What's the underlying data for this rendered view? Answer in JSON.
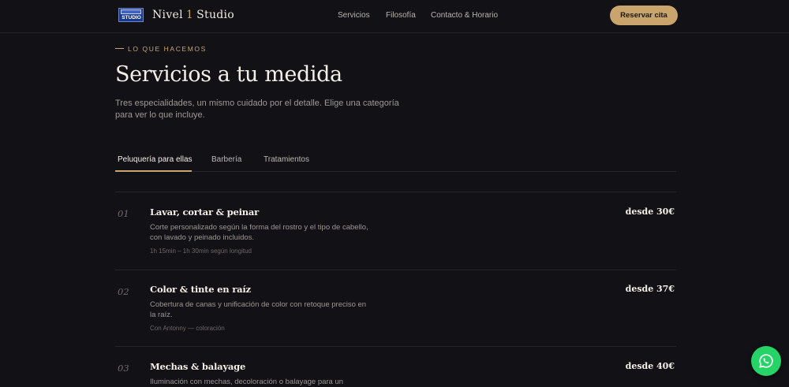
{
  "header": {
    "logo_text_top": "NIVEL 1",
    "logo_text_bottom": "STUDIO",
    "brand_left": "Nivel",
    "brand_num": "1",
    "brand_right": "Studio",
    "nav": [
      "Servicios",
      "Filosofía",
      "Contacto & Horario"
    ],
    "cta_label": "Reservar cita"
  },
  "hero": {
    "eyebrow": "LO QUE HACEMOS",
    "title": "Servicios a tu medida",
    "intro": "Tres especialidades, un mismo cuidado por el detalle. Elige una categoría para ver lo que incluye."
  },
  "tabs": [
    {
      "label": "Peluquería para ellas",
      "active": true
    },
    {
      "label": "Barbería",
      "active": false
    },
    {
      "label": "Tratamientos",
      "active": false
    }
  ],
  "services": [
    {
      "num": "01",
      "name": "Lavar, cortar & peinar",
      "price": "desde 30€",
      "desc": "Corte personalizado según la forma del rostro y el tipo de cabello, con lavado y peinado incluidos.",
      "meta": "1h 15min – 1h 30min según longitud"
    },
    {
      "num": "02",
      "name": "Color & tinte en raíz",
      "price": "desde 37€",
      "desc": "Cobertura de canas y unificación de color con retoque preciso en la raíz.",
      "meta": "Con Antonny — coloración"
    },
    {
      "num": "03",
      "name": "Mechas & balayage",
      "price": "desde 40€",
      "desc": "Iluminación con mechas, decoloración o balayage para un",
      "meta": ""
    }
  ],
  "colors": {
    "background": "#121116",
    "accent": "#c9a46c",
    "whatsapp": "#25d366"
  },
  "icons": {
    "floating_button": "whatsapp-icon"
  }
}
